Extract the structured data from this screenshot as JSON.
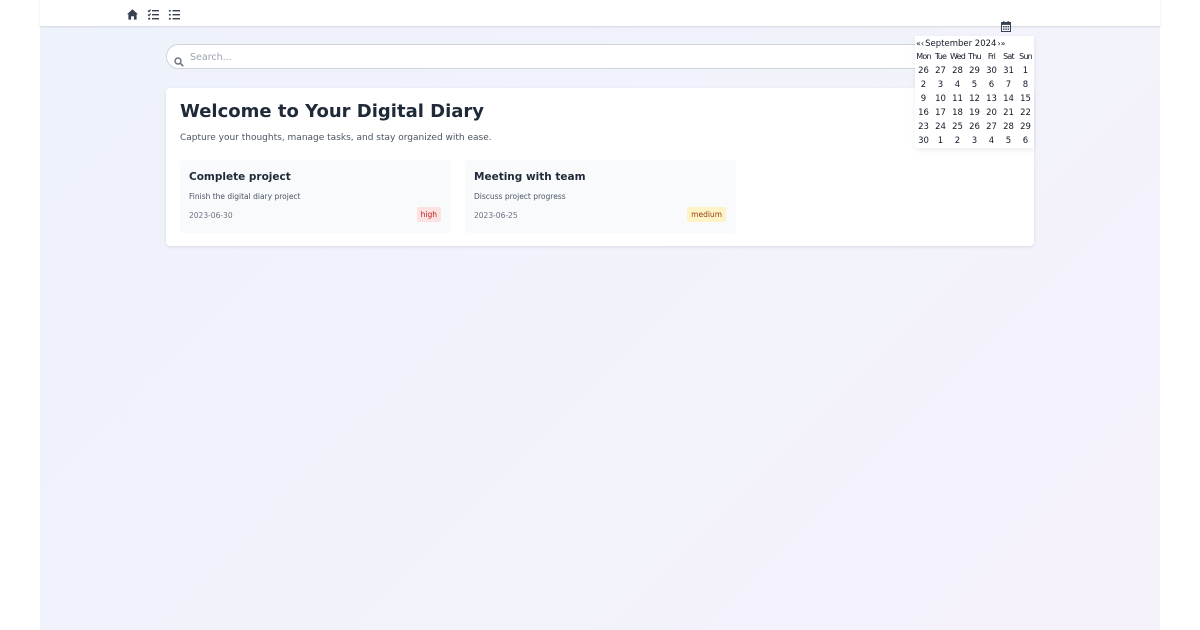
{
  "nav": {
    "icons": [
      "home-icon",
      "tasks-icon",
      "list-icon"
    ],
    "calendar_toggle_icon": "calendar-icon"
  },
  "search": {
    "placeholder": "Search...",
    "value": ""
  },
  "main": {
    "title": "Welcome to Your Digital Diary",
    "subtitle": "Capture your thoughts, manage tasks, and stay organized with ease.",
    "tasks": [
      {
        "title": "Complete project",
        "description": "Finish the digital diary project",
        "date": "2023-06-30",
        "priority": "high",
        "priority_bg": "#fde2e2",
        "priority_color": "#b91c1c"
      },
      {
        "title": "Meeting with team",
        "description": "Discuss project progress",
        "date": "2023-06-25",
        "priority": "medium",
        "priority_bg": "#fef3c7",
        "priority_color": "#92400e"
      }
    ]
  },
  "calendar": {
    "prev_year": "«",
    "prev_month": "‹",
    "month_label": "September 2024",
    "next_month": "›",
    "next_year": "»",
    "weekdays": [
      "Mon",
      "Tue",
      "Wed",
      "Thu",
      "Fri",
      "Sat",
      "Sun"
    ],
    "weeks": [
      [
        "26",
        "27",
        "28",
        "29",
        "30",
        "31",
        "1"
      ],
      [
        "2",
        "3",
        "4",
        "5",
        "6",
        "7",
        "8"
      ],
      [
        "9",
        "10",
        "11",
        "12",
        "13",
        "14",
        "15"
      ],
      [
        "16",
        "17",
        "18",
        "19",
        "20",
        "21",
        "22"
      ],
      [
        "23",
        "24",
        "25",
        "26",
        "27",
        "28",
        "29"
      ],
      [
        "30",
        "1",
        "2",
        "3",
        "4",
        "5",
        "6"
      ]
    ]
  }
}
